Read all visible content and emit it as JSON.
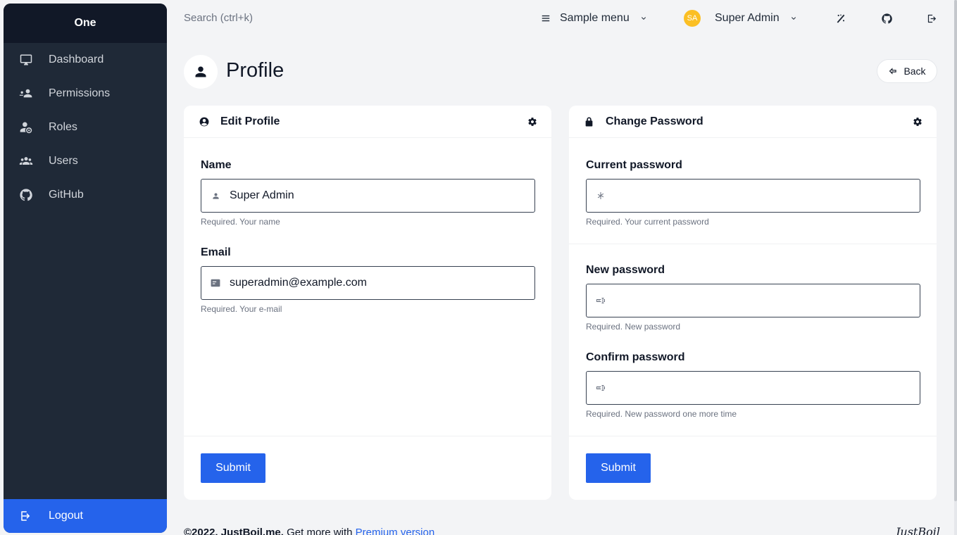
{
  "sidebar": {
    "brand": "One",
    "items": [
      {
        "label": "Dashboard",
        "icon": "monitor-icon"
      },
      {
        "label": "Permissions",
        "icon": "permissions-icon"
      },
      {
        "label": "Roles",
        "icon": "roles-icon"
      },
      {
        "label": "Users",
        "icon": "users-icon"
      },
      {
        "label": "GitHub",
        "icon": "github-icon"
      }
    ],
    "logout": "Logout"
  },
  "topbar": {
    "search_placeholder": "Search (ctrl+k)",
    "sample_menu": "Sample menu",
    "avatar_initials": "SA",
    "user_name": "Super Admin"
  },
  "page": {
    "title": "Profile",
    "back": "Back"
  },
  "edit_profile": {
    "title": "Edit Profile",
    "name_label": "Name",
    "name_value": "Super Admin",
    "name_help": "Required. Your name",
    "email_label": "Email",
    "email_value": "superadmin@example.com",
    "email_help": "Required. Your e-mail",
    "submit": "Submit"
  },
  "change_password": {
    "title": "Change Password",
    "current_label": "Current password",
    "current_help": "Required. Your current password",
    "new_label": "New password",
    "new_help": "Required. New password",
    "confirm_label": "Confirm password",
    "confirm_help": "Required. New password one more time",
    "submit": "Submit"
  },
  "footer": {
    "copyright": "©2022, JustBoil.me.",
    "text": "Get more with",
    "link": "Premium version",
    "logo": "JustBoil"
  },
  "colors": {
    "sidebar_bg": "#1f2937",
    "brand_bg": "#111827",
    "accent": "#2563eb",
    "avatar": "#fbbf24",
    "page_bg": "#f3f4f6"
  }
}
